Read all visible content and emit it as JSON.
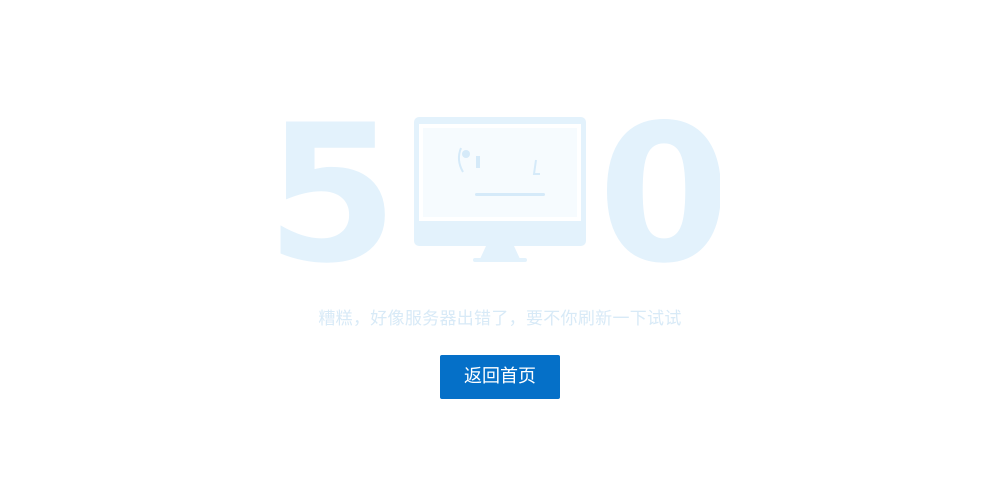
{
  "error_code": {
    "first_digit": "5",
    "last_digit": "0"
  },
  "message": "糟糕，好像服务器出错了，要不你刷新一下试试",
  "home_button": {
    "label": "返回首页"
  },
  "icons": {
    "monitor": "monitor-icon"
  },
  "colors": {
    "illustration": "#e3f2fc",
    "illustration_dark": "#d5eaf9",
    "message_text": "#d8eaf7",
    "button_bg": "#0570c8",
    "button_text": "#ffffff"
  }
}
